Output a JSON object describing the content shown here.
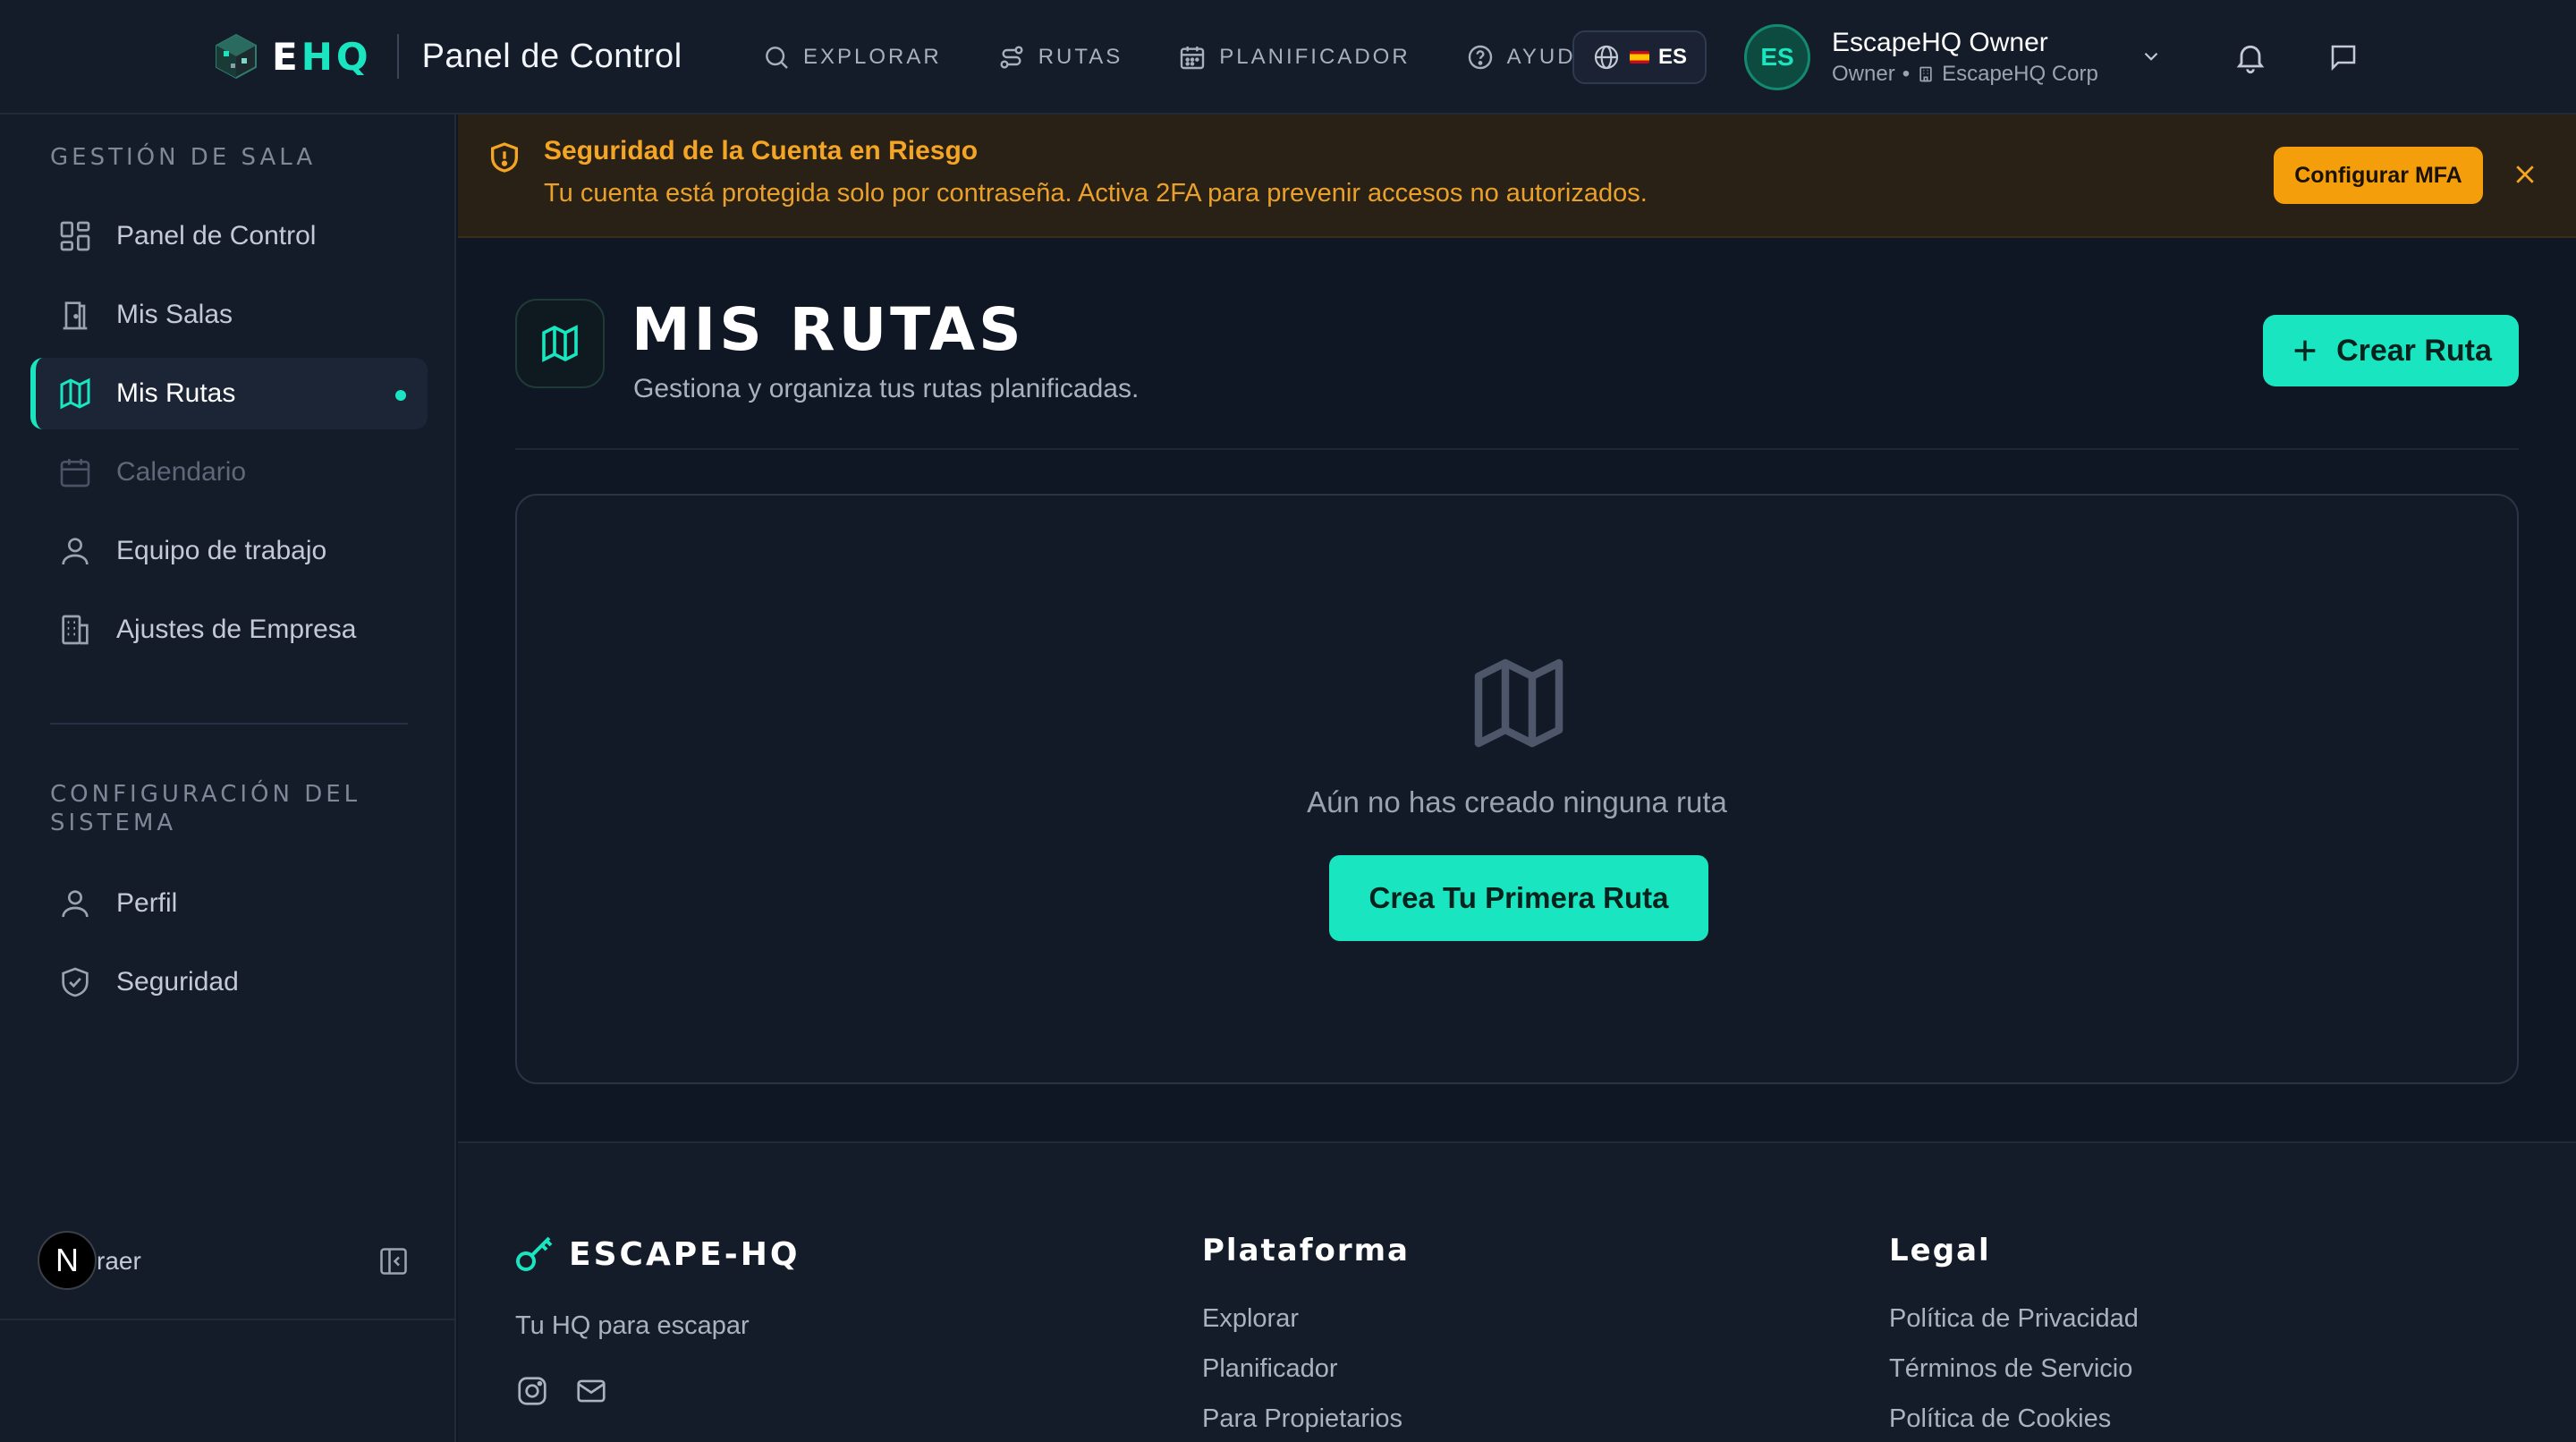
{
  "brand": {
    "logo_e": "E",
    "logo_hq": "HQ",
    "title": "Panel de Control"
  },
  "nav": {
    "items": [
      {
        "label": "EXPLORAR",
        "icon": "search-icon"
      },
      {
        "label": "RUTAS",
        "icon": "route-icon"
      },
      {
        "label": "PLANIFICADOR",
        "icon": "calendar-icon"
      },
      {
        "label": "AYUDA",
        "icon": "help-icon"
      }
    ],
    "language": "ES"
  },
  "user": {
    "initials": "ES",
    "name": "EscapeHQ Owner",
    "role": "Owner",
    "company": "EscapeHQ Corp"
  },
  "sidebar": {
    "section1_title": "GESTIÓN DE SALA",
    "items": [
      {
        "label": "Panel de Control",
        "icon": "dashboard-icon"
      },
      {
        "label": "Mis Salas",
        "icon": "door-icon"
      },
      {
        "label": "Mis Rutas",
        "icon": "map-icon",
        "active": true
      },
      {
        "label": "Calendario",
        "icon": "calendar-icon",
        "disabled": true
      },
      {
        "label": "Equipo de trabajo",
        "icon": "user-icon"
      },
      {
        "label": "Ajustes de Empresa",
        "icon": "building-icon"
      }
    ],
    "section2_title": "CONFIGURACIÓN DEL SISTEMA",
    "items2": [
      {
        "label": "Perfil",
        "icon": "user-icon"
      },
      {
        "label": "Seguridad",
        "icon": "shield-icon"
      }
    ],
    "badge": "N",
    "collapse_label": "raer"
  },
  "alert": {
    "title": "Seguridad de la Cuenta en Riesgo",
    "text": "Tu cuenta está protegida solo por contraseña. Activa 2FA para prevenir accesos no autorizados.",
    "button": "Configurar MFA",
    "color": "#f5a524"
  },
  "main": {
    "title": "MIS RUTAS",
    "subtitle": "Gestiona y organiza tus rutas planificadas.",
    "create_button": "Crear Ruta",
    "empty_text": "Aún no has creado ninguna ruta",
    "empty_button": "Crea Tu Primera Ruta"
  },
  "footer": {
    "brand": "ESCAPE-HQ",
    "tagline": "Tu HQ para escapar",
    "platform_title": "Plataforma",
    "platform_links": [
      "Explorar",
      "Planificador",
      "Para Propietarios"
    ],
    "legal_title": "Legal",
    "legal_links": [
      "Política de Privacidad",
      "Términos de Servicio",
      "Política de Cookies"
    ]
  },
  "colors": {
    "accent": "#19e6c1",
    "warning": "#f59e0b",
    "background": "#0f1624"
  }
}
